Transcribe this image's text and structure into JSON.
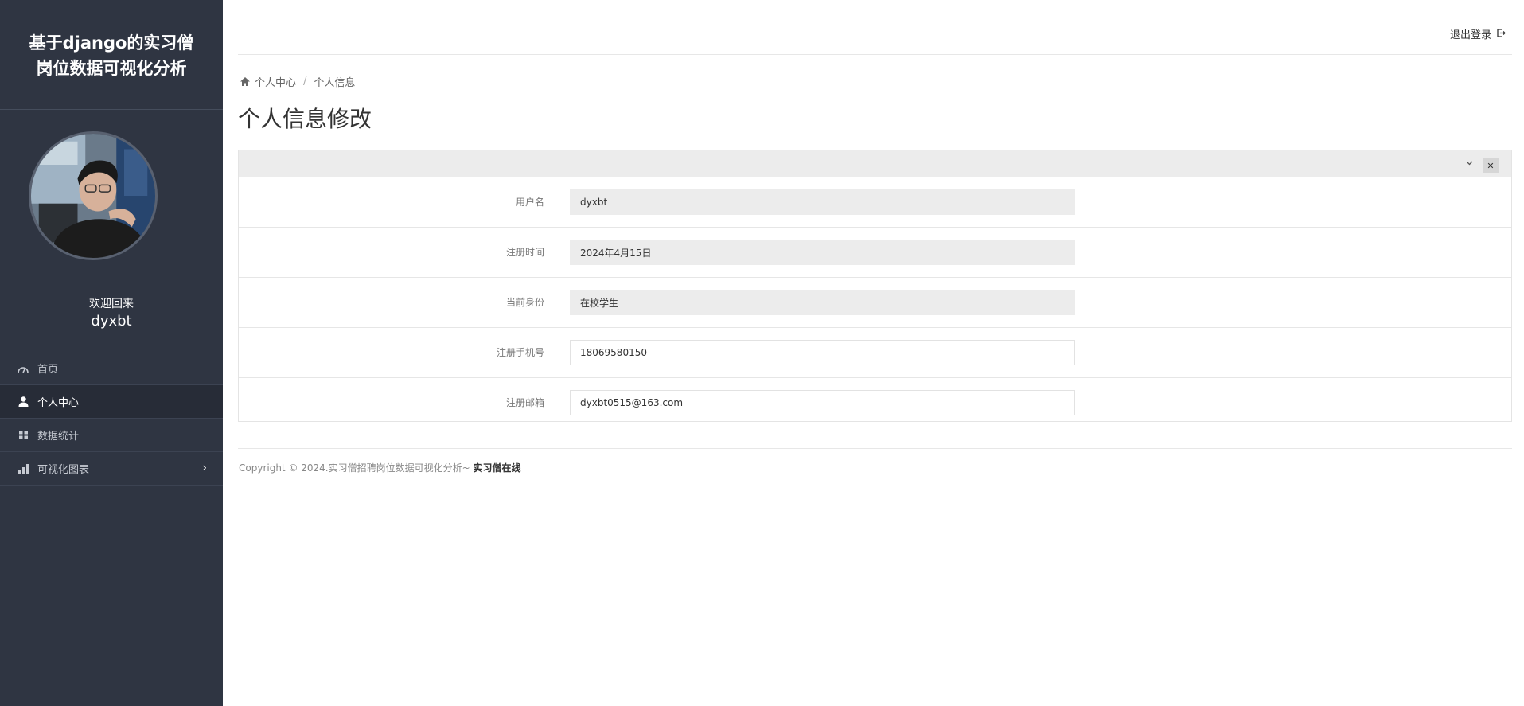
{
  "sidebar": {
    "title_line1": "基于django的实习僧",
    "title_line2": "岗位数据可视化分析",
    "welcome": "欢迎回来",
    "username": "dyxbt",
    "items": [
      {
        "label": "首页",
        "icon": "dashboard-icon"
      },
      {
        "label": "个人中心",
        "icon": "user-icon",
        "active": true
      },
      {
        "label": "数据统计",
        "icon": "grid-icon"
      },
      {
        "label": "可视化图表",
        "icon": "bar-chart-icon"
      }
    ]
  },
  "header": {
    "logout_label": "退出登录"
  },
  "breadcrumb": {
    "home": "个人中心",
    "current": "个人信息"
  },
  "page": {
    "title": "个人信息修改"
  },
  "form": {
    "fields": [
      {
        "label": "用户名",
        "value": "dyxbt",
        "readonly": true
      },
      {
        "label": "注册时间",
        "value": "2024年4月15日",
        "readonly": true
      },
      {
        "label": "当前身份",
        "value": "在校学生",
        "readonly": true
      },
      {
        "label": "注册手机号",
        "value": "18069580150",
        "readonly": false
      },
      {
        "label": "注册邮箱",
        "value": "dyxbt0515@163.com",
        "readonly": false
      }
    ]
  },
  "footer": {
    "copyright": "Copyright © 2024.实习僧招聘岗位数据可视化分析~ ",
    "brand": "实习僧在线"
  },
  "colors": {
    "sidebar_bg": "#2f3542",
    "sidebar_active": "#272c37",
    "readonly_bg": "#ececec"
  }
}
